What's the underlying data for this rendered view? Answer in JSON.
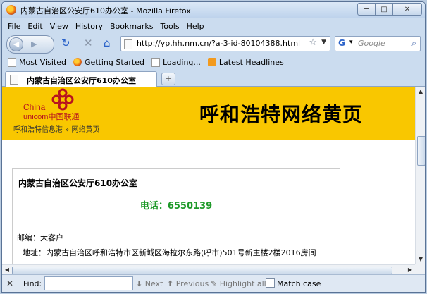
{
  "window": {
    "title": "内蒙古自治区公安厅610办公室 - Mozilla Firefox",
    "minimize_glyph": "─",
    "maximize_glyph": "□",
    "close_glyph": "✕"
  },
  "menu": [
    "File",
    "Edit",
    "View",
    "History",
    "Bookmarks",
    "Tools",
    "Help"
  ],
  "nav": {
    "url": "http://yp.hh.nm.cn/?a-3-id-80104388.html",
    "search_placeholder": "Google"
  },
  "bookmarks": [
    {
      "label": "Most Visited",
      "icon": "most-visited-icon"
    },
    {
      "label": "Getting Started",
      "icon": "getting-started-icon"
    },
    {
      "label": "Loading...",
      "icon": "page-icon"
    },
    {
      "label": "Latest Headlines",
      "icon": "rss-icon"
    }
  ],
  "tab": {
    "title": "内蒙古自治区公安厅610办公室",
    "new_tab": "+"
  },
  "page": {
    "logo_china": "China",
    "logo_unicom": "unicom中国联通",
    "breadcrumb": "呼和浩特信息港 » 网络黄页",
    "banner_title": "呼和浩特网络黄页",
    "name": "内蒙古自治区公安厅610办公室",
    "tel": "电话：6550139",
    "zip": "邮编：大客户",
    "address": "地址：内蒙古自治区呼和浩特市区新城区海拉尔东路(呼市)501号新主楼2楼2016房间"
  },
  "findbar": {
    "label": "Find:",
    "next": "Next",
    "previous": "Previous",
    "highlight": "Highlight all",
    "match_case": "Match case"
  },
  "colors": {
    "banner": "#f9c700",
    "tel": "#1f9a2a",
    "logo": "#b7121f"
  }
}
